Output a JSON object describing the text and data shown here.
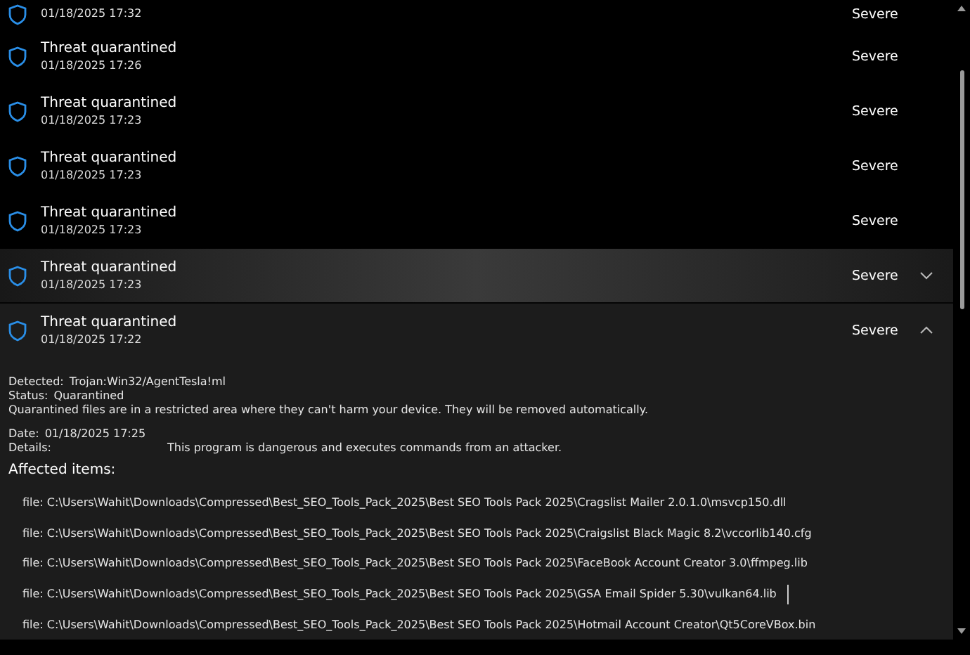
{
  "threats": [
    {
      "date": "01/18/2025 17:32",
      "severity": "Severe",
      "hovered": false,
      "expanded": false
    },
    {
      "title": "Threat quarantined",
      "date": "01/18/2025 17:26",
      "severity": "Severe",
      "hovered": false,
      "expanded": false
    },
    {
      "title": "Threat quarantined",
      "date": "01/18/2025 17:23",
      "severity": "Severe",
      "hovered": false,
      "expanded": false
    },
    {
      "title": "Threat quarantined",
      "date": "01/18/2025 17:23",
      "severity": "Severe",
      "hovered": false,
      "expanded": false
    },
    {
      "title": "Threat quarantined",
      "date": "01/18/2025 17:23",
      "severity": "Severe",
      "hovered": false,
      "expanded": false
    },
    {
      "title": "Threat quarantined",
      "date": "01/18/2025 17:23",
      "severity": "Severe",
      "hovered": true,
      "expanded": false
    },
    {
      "title": "Threat quarantined",
      "date": "01/18/2025 17:22",
      "severity": "Severe",
      "hovered": false,
      "expanded": true
    }
  ],
  "details": {
    "detected_label": "Detected:",
    "detected": "Trojan:Win32/AgentTesla!ml",
    "status_label": "Status:",
    "status": "Quarantined",
    "note": "Quarantined files are in a restricted area where they can't harm your device. They will be removed automatically.",
    "date_label": "Date:",
    "date": "01/18/2025 17:25",
    "details_label": "Details:",
    "details": "This program is dangerous and executes commands from an attacker.",
    "affected_heading": "Affected items:",
    "files": [
      {
        "path": "file: C:\\Users\\Wahit\\Downloads\\Compressed\\Best_SEO_Tools_Pack_2025\\Best SEO Tools Pack 2025\\Cragslist Mailer 2.0.1.0\\msvcp150.dll",
        "cursor": false
      },
      {
        "path": "file: C:\\Users\\Wahit\\Downloads\\Compressed\\Best_SEO_Tools_Pack_2025\\Best SEO Tools Pack 2025\\Craigslist Black Magic 8.2\\vccorlib140.cfg",
        "cursor": false
      },
      {
        "path": "file: C:\\Users\\Wahit\\Downloads\\Compressed\\Best_SEO_Tools_Pack_2025\\Best SEO Tools Pack 2025\\FaceBook Account Creator 3.0\\ffmpeg.lib",
        "cursor": false
      },
      {
        "path": "file: C:\\Users\\Wahit\\Downloads\\Compressed\\Best_SEO_Tools_Pack_2025\\Best SEO Tools Pack 2025\\GSA Email Spider 5.30\\vulkan64.lib",
        "cursor": true
      },
      {
        "path": "file: C:\\Users\\Wahit\\Downloads\\Compressed\\Best_SEO_Tools_Pack_2025\\Best SEO Tools Pack 2025\\Hotmail Account Creator\\Qt5CoreVBox.bin",
        "cursor": false
      }
    ]
  }
}
